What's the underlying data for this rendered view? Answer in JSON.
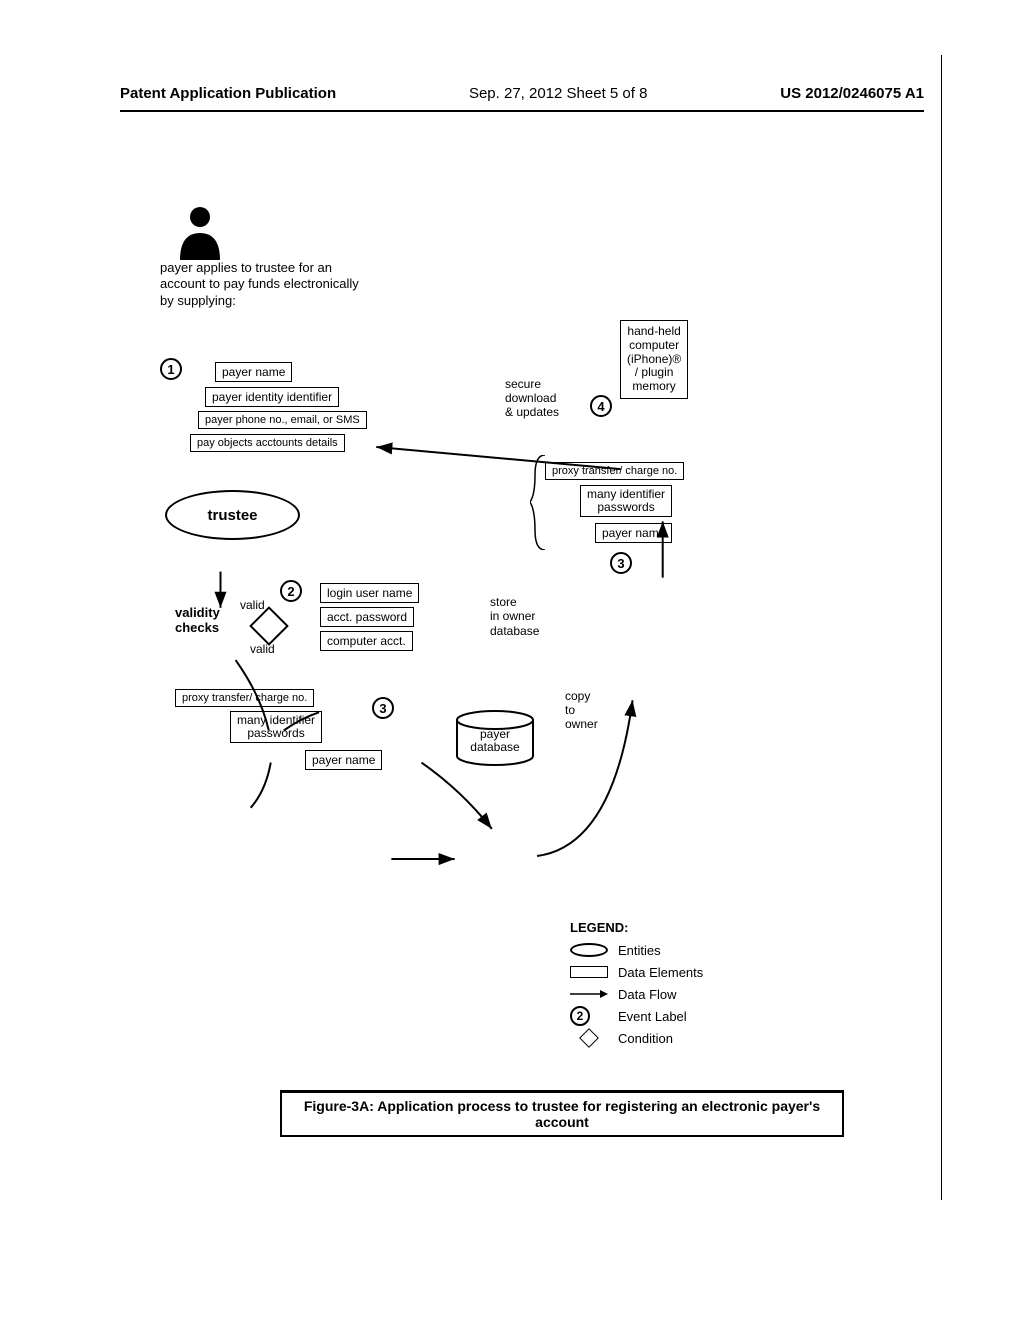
{
  "header": {
    "left": "Patent Application Publication",
    "center": "Sep. 27, 2012  Sheet 5 of 8",
    "right": "US 2012/0246075 A1"
  },
  "payer_text": "payer applies to trustee for an account to pay funds electronically by supplying:",
  "steps": {
    "one": "1",
    "two": "2",
    "three": "3",
    "four": "4"
  },
  "supply_boxes": {
    "name": "payer name",
    "id": "payer identity identifier",
    "phone": "payer phone no., email, or SMS",
    "pay": "pay objects acctounts details"
  },
  "trustee": "trustee",
  "validity": {
    "label": "validity\nchecks",
    "valid1": "valid",
    "valid2": "valid"
  },
  "login_boxes": {
    "user": "login user name",
    "pass": "acct. password",
    "comp": "computer acct."
  },
  "store_label": "store\nin owner\ndatabase",
  "group3a": {
    "proxy": "proxy transfer/ charge no.",
    "many": "many identifier\npasswords",
    "pname": "payer name"
  },
  "payer_db": "payer\ndatabase",
  "copy_label": "copy\nto\nowner",
  "group3b": {
    "proxy": "proxy transfer/ charge no.",
    "many": "many identifier\npasswords",
    "pname": "payer name"
  },
  "handheld": "hand-held\ncomputer\n(iPhone)®\n/ plugin\nmemory",
  "secure_dl": "secure\ndownload\n& updates",
  "legend": {
    "title": "LEGEND:",
    "entities": "Entities",
    "data_el": "Data Elements",
    "flow": "Data Flow",
    "event": "Event Label",
    "cond": "Condition",
    "two": "2"
  },
  "caption": "Figure-3A: Application process to trustee for registering an electronic payer's account"
}
